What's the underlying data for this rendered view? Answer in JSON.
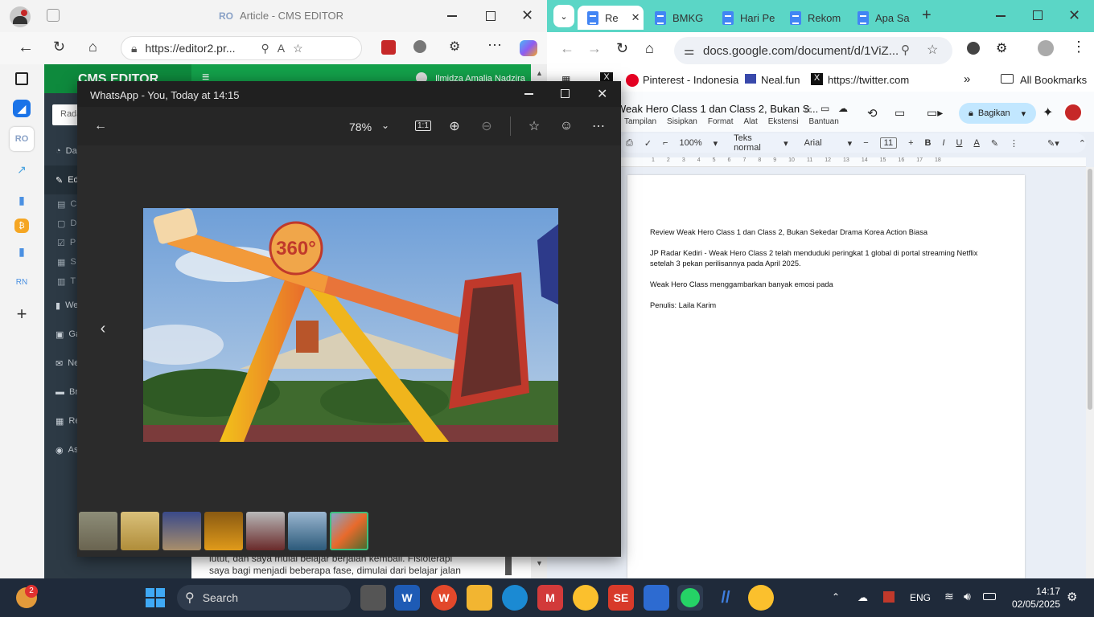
{
  "edge": {
    "tab_title": "Article - CMS EDITOR",
    "url": "https://editor2.pr...",
    "cms": {
      "brand": "CMS EDITOR",
      "user": "Ilmidza Amalia Nadzira",
      "search_placeholder": "Rada",
      "sidebar": [
        {
          "icon": "dashboard-icon",
          "label": "Da"
        },
        {
          "icon": "edit-icon",
          "label": "Ed"
        },
        {
          "icon": "create-icon",
          "label": "C",
          "sub": true
        },
        {
          "icon": "draft-icon",
          "label": "D",
          "sub": true
        },
        {
          "icon": "check-icon",
          "label": "P",
          "sub": true
        },
        {
          "icon": "calendar-icon",
          "label": "S",
          "sub": true
        },
        {
          "icon": "trash-icon",
          "label": "T",
          "sub": true
        },
        {
          "icon": "web-icon",
          "label": "We"
        },
        {
          "icon": "gallery-icon",
          "label": "Ga"
        },
        {
          "icon": "news-icon",
          "label": "Ne"
        },
        {
          "icon": "breaking-icon",
          "label": "Br"
        },
        {
          "icon": "report-icon",
          "label": "Re"
        },
        {
          "icon": "assets-icon",
          "label": "As"
        }
      ],
      "article_line1": "lutut, dan saya mulai belajar berjalan kembali. Fisioterapi",
      "article_line2": "saya bagi menjadi beberapa fase, dimulai dari belajar jalan"
    }
  },
  "chrome": {
    "tabs": [
      "Re",
      "BMKG",
      "Hari Pe",
      "Rekom",
      "Apa Sa"
    ],
    "url": "docs.google.com/document/d/1ViZ...",
    "bookmarks": [
      "Pinterest - Indonesia",
      "Neal.fun",
      "https://twitter.com"
    ],
    "all_bookmarks": "All Bookmarks",
    "doc_title": "Weak Hero Class 1 dan Class 2, Bukan S...",
    "menu": [
      "Tampilan",
      "Sisipkan",
      "Format",
      "Alat",
      "Ekstensi",
      "Bantuan"
    ],
    "share_label": "Bagikan",
    "toolbar": {
      "zoom": "100%",
      "style": "Teks normal",
      "font": "Arial",
      "size": "11"
    },
    "ruler_marks": [
      "1",
      "2",
      "3",
      "4",
      "5",
      "6",
      "7",
      "8",
      "9",
      "10",
      "11",
      "12",
      "13",
      "14",
      "15",
      "16",
      "17",
      "18"
    ],
    "doc_paragraphs": [
      "Review Weak Hero Class 1 dan Class 2, Bukan Sekedar Drama Korea Action Biasa",
      "JP Radar Kediri - Weak Hero Class 2 telah menduduki peringkat 1 global di portal streaming Netflix setelah 3 pekan perilisannya pada April 2025.",
      "Weak Hero Class menggambarkan banyak emosi pada",
      "Penulis: Laila Karim"
    ]
  },
  "viewer": {
    "title": "WhatsApp - You, Today at 14:15",
    "zoom": "78%",
    "actual_size": "1:1",
    "photo_sign": "360°",
    "thumb_count": 7
  },
  "taskbar": {
    "search": "Search",
    "lang": "ENG",
    "time": "14:17",
    "date": "02/05/2025",
    "notif_count": "2"
  }
}
